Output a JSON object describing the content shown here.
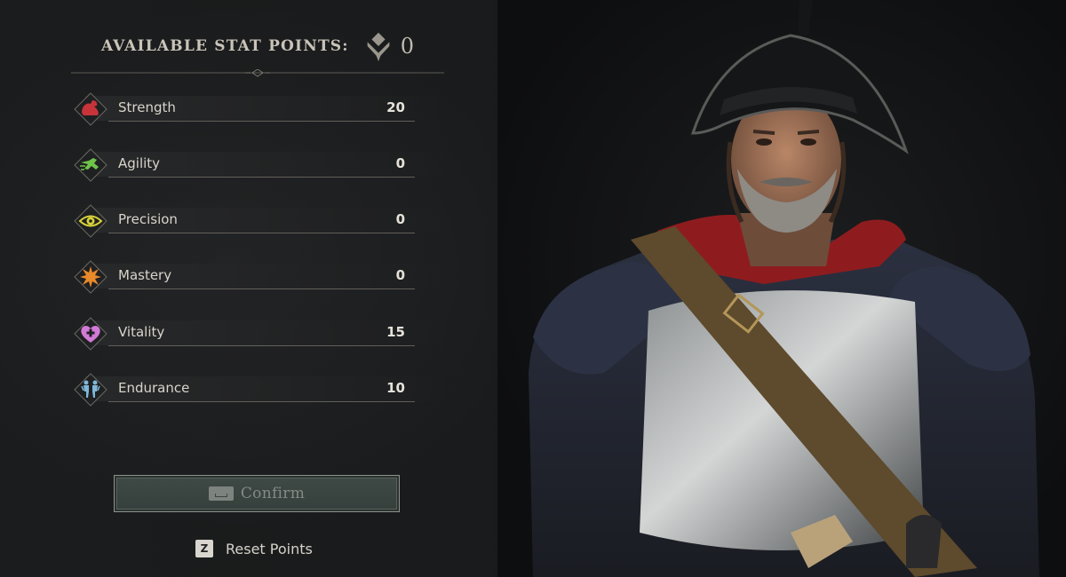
{
  "header": {
    "title": "AVAILABLE STAT POINTS:",
    "points": "0"
  },
  "stats": [
    {
      "label": "Strength",
      "value": "20",
      "icon": "flexed-arm-icon",
      "color": "#c8343a"
    },
    {
      "label": "Agility",
      "value": "0",
      "icon": "running-figure-icon",
      "color": "#6fc24a"
    },
    {
      "label": "Precision",
      "value": "0",
      "icon": "eye-icon",
      "color": "#d8d23a"
    },
    {
      "label": "Mastery",
      "value": "0",
      "icon": "burst-icon",
      "color": "#e8892a"
    },
    {
      "label": "Vitality",
      "value": "15",
      "icon": "heart-plus-icon",
      "color": "#d27ad6"
    },
    {
      "label": "Endurance",
      "value": "10",
      "icon": "figures-icon",
      "color": "#7fb8d9"
    }
  ],
  "actions": {
    "confirm_label": "Confirm",
    "reset_key": "Z",
    "reset_label": "Reset Points"
  }
}
